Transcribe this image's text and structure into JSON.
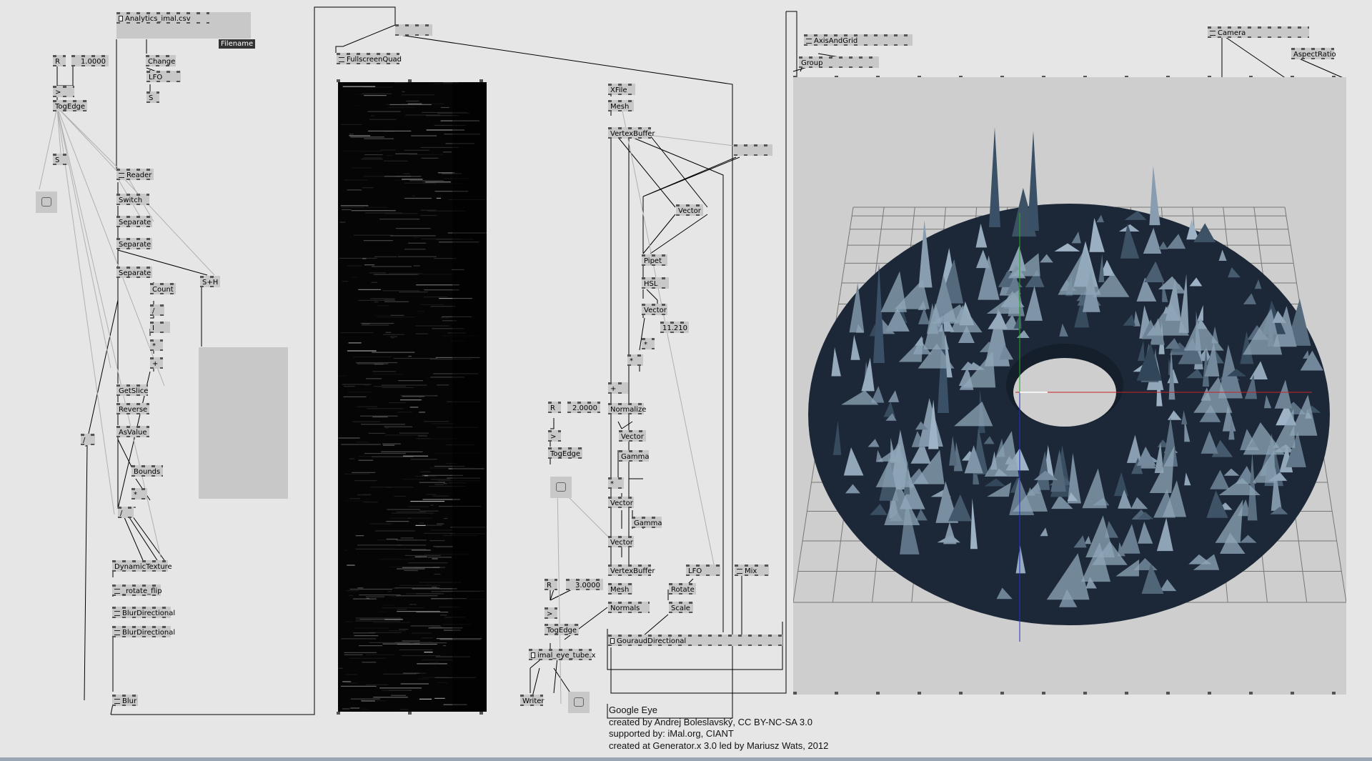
{
  "nodes": {
    "analytics": "Analytics_imal.csv",
    "filename_badge": "Filename",
    "change": "Change",
    "lfo1": "LFO",
    "s1": "S",
    "r1": "R",
    "val1": "1.0000",
    "gt1": ">",
    "togedge1": "TogEdge",
    "s2": "S",
    "reader": "Reader",
    "switch": "Switch",
    "separate1": "Separate",
    "separate2": "Separate",
    "separate3": "Separate",
    "count": "Count",
    "sh": "S+H",
    "slash1": "/",
    "i1": "I",
    "star1": "*",
    "plus1": "+",
    "getslice": "GetSlice",
    "reverse": "Reverse",
    "asvalue": "AsValue",
    "bounds": "Bounds",
    "star2": "*",
    "slash2": "/",
    "slash3": "/",
    "dyntex": "DynamicTexture",
    "rotateflip": "_rotate_flip",
    "blurdir1": "BlurDirectional",
    "blurdir2": "BlurDirectional",
    "blur": "Blur",
    "fsq": "FullscreenQuad",
    "xfile": "XFile",
    "mesh1": "Mesh",
    "vbuf1": "VertexBuffer",
    "vector1": "Vector",
    "pipet": "Pipet",
    "hsl": "HSL",
    "vector2": "Vector",
    "val2": "11.210",
    "star3": "*",
    "star4": "*",
    "plus2": "+",
    "normalize": "Normalize",
    "vector3": "Vector",
    "gamma1": "Gamma",
    "star5": "*",
    "vector4": "Vector",
    "gamma2": "Gamma",
    "vector5": "Vector",
    "vbuf2": "VertexBuffer",
    "mesh2": "Mesh",
    "normals": "Normals",
    "lfo2": "LFO",
    "rotate": "Rotate",
    "scale": "Scale",
    "mix": "Mix",
    "gouraud": "GouraudDirectional",
    "r2": "R",
    "val3": "2.0000",
    "gt2": ">",
    "togedge2": "TogEdge",
    "r3": "R",
    "val4": "3.0000",
    "gt3": ">",
    "togedge3": "TogEdge",
    "tubefile": "imal_eye_tube.x",
    "writer": "Writer",
    "axisgrid": "AxisAndGrid",
    "group": "Group",
    "camera": "Camera",
    "aspect": "AspectRatio"
  },
  "credits": {
    "line1": "Google Eye",
    "line2": "created by Andrej Boleslavský, CC BY-NC-SA 3.0",
    "line3": "supported by: iMal.org, CIANT",
    "line4": "created at Generator.x 3.0 led by Mariusz Wats, 2012"
  },
  "colors": {
    "patch_bg": "#e6e6e6",
    "node_bg": "#c8c8c8",
    "render_bg": "#cecece",
    "mesh_dark": "#1c2838",
    "mesh_light": "#8fa7b8",
    "axis_x": "#cc2222",
    "axis_y": "#22aa22",
    "axis_z": "#2233cc"
  }
}
